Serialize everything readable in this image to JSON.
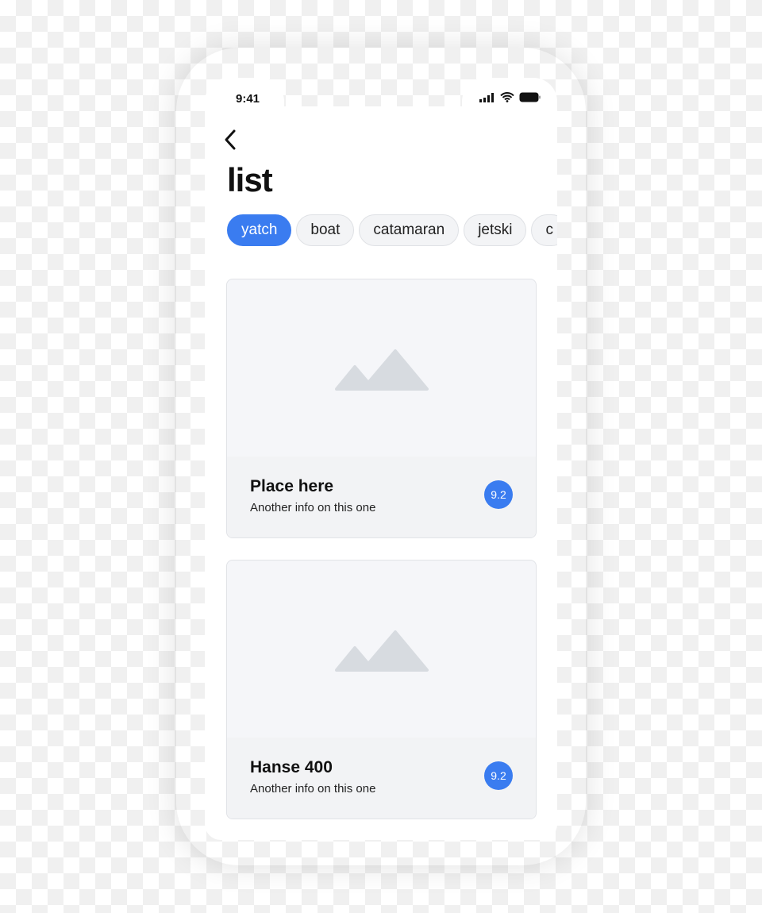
{
  "status_bar": {
    "time": "9:41"
  },
  "header": {
    "title": "list"
  },
  "colors": {
    "accent": "#3a7cf0",
    "card_bg": "#f2f3f5"
  },
  "chips": [
    {
      "label": "yatch",
      "active": true
    },
    {
      "label": "boat"
    },
    {
      "label": "catamaran"
    },
    {
      "label": "jetski"
    },
    {
      "label": "c"
    }
  ],
  "cards": [
    {
      "title": "Place here",
      "subtitle": "Another info on this one",
      "rating": "9.2",
      "image": "image-placeholder-icon"
    },
    {
      "title": "Hanse 400",
      "subtitle": "Another info on this one",
      "rating": "9.2",
      "image": "image-placeholder-icon"
    }
  ]
}
